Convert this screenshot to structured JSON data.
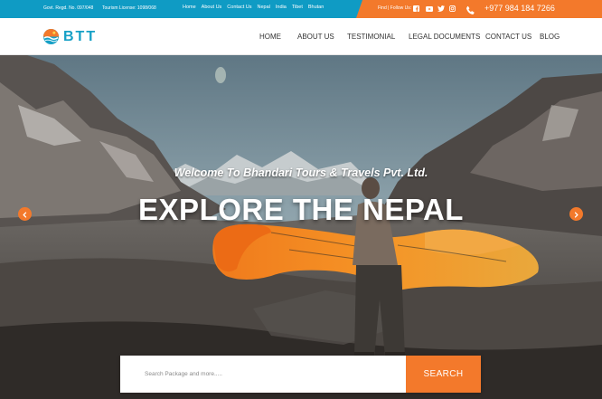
{
  "colors": {
    "top_blue": "#0f9bc4",
    "accent_orange": "#f3792b",
    "brand_blue": "#16a0c6"
  },
  "topbar": {
    "govt_reg": "Govt. Regd. No. 097/048",
    "tourism_license": "Tourism License: 1098/068",
    "links": [
      "Home",
      "About Us",
      "Contact Us",
      "Nepal",
      "India",
      "Tibet",
      "Bhutan"
    ],
    "follow_label": "Find | Follow Us:",
    "social_icons": [
      "facebook-icon",
      "youtube-icon",
      "twitter-icon",
      "instagram-icon"
    ],
    "phone_icon": "phone-icon",
    "phone": "+977 984 184 7266"
  },
  "header": {
    "logo_text": "BTT",
    "nav": [
      "HOME",
      "ABOUT US",
      "TESTIMONIAL",
      "LEGAL DOCUMENTS",
      "CONTACT US",
      "BLOG"
    ]
  },
  "hero": {
    "welcome": "Welcome To Bhandari Tours & Travels Pvt. Ltd.",
    "heading": "EXPLORE THE NEPAL",
    "prev_icon": "chevron-left-icon",
    "next_icon": "chevron-right-icon"
  },
  "search": {
    "placeholder": "Search Package and more.....",
    "button_label": "SEARCH"
  }
}
